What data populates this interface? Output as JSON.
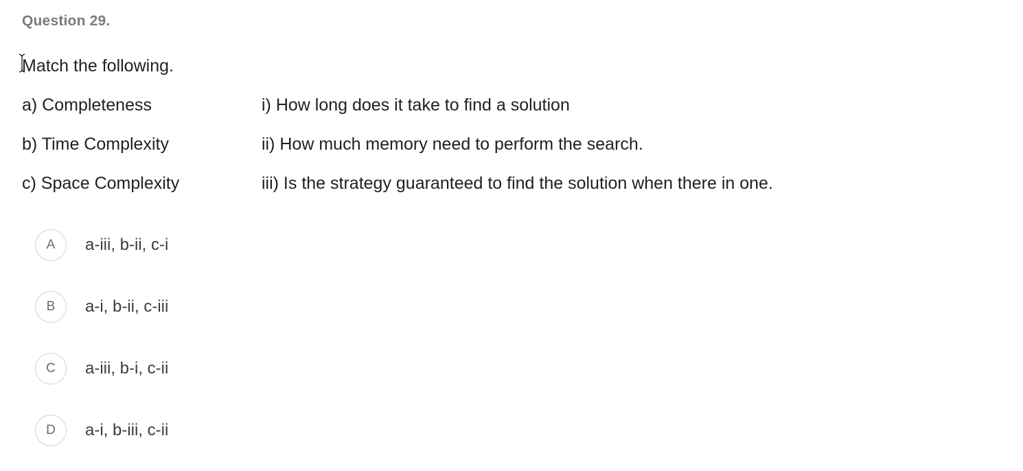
{
  "question": {
    "number_label": "Question 29.",
    "prompt": "Match the following."
  },
  "matches": [
    {
      "left": "a) Completeness",
      "right": "i) How long does it take to find a solution"
    },
    {
      "left": "b) Time Complexity",
      "right": "ii) How much memory need to perform the search."
    },
    {
      "left": "c) Space Complexity",
      "right": "iii) Is the strategy guaranteed to find the solution when there in one."
    }
  ],
  "options": [
    {
      "letter": "A",
      "text": "a-iii, b-ii, c-i"
    },
    {
      "letter": "B",
      "text": "a-i, b-ii, c-iii"
    },
    {
      "letter": "C",
      "text": "a-iii, b-i, c-ii"
    },
    {
      "letter": "D",
      "text": "a-i, b-iii, c-ii"
    }
  ],
  "icons": {
    "cursor": "text-cursor-icon"
  }
}
